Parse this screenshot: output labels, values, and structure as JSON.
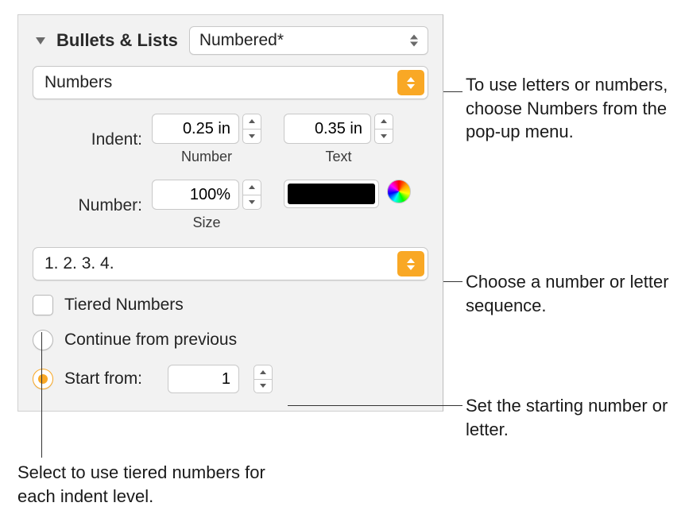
{
  "section_title": "Bullets & Lists",
  "style_popup": {
    "value": "Numbered*"
  },
  "type_popup": {
    "value": "Numbers"
  },
  "indent": {
    "label": "Indent:",
    "number_value": "0.25 in",
    "number_sublabel": "Number",
    "text_value": "0.35 in",
    "text_sublabel": "Text"
  },
  "number": {
    "label": "Number:",
    "size_value": "100%",
    "size_sublabel": "Size",
    "color": "#000000"
  },
  "sequence_popup": {
    "value": "1. 2. 3. 4."
  },
  "tiered": {
    "label": "Tiered Numbers",
    "checked": false
  },
  "continuation": {
    "continue_label": "Continue from previous",
    "start_label": "Start from:",
    "start_value": "1",
    "selected": "start"
  },
  "annotations": {
    "type": "To use letters or numbers, choose Numbers from the pop-up menu.",
    "sequence": "Choose a number or letter sequence.",
    "start": "Set the starting number or letter.",
    "tiered": "Select to use tiered numbers for each indent level."
  }
}
